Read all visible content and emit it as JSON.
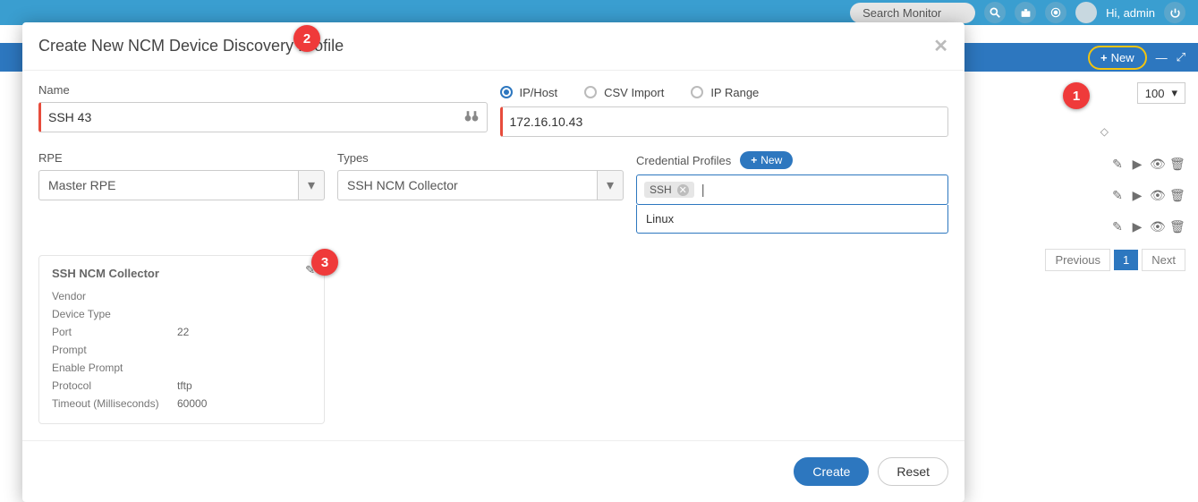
{
  "topbar": {
    "search_placeholder": "Search Monitor",
    "greeting": "Hi, admin"
  },
  "bluebar": {
    "new_label": "New"
  },
  "page": {
    "page_size": "100",
    "pager_prev": "Previous",
    "pager_next": "Next",
    "pager_current": "1"
  },
  "modal": {
    "title": "Create New NCM Device Discovery Profile",
    "name_label": "Name",
    "name_value": "SSH 43",
    "rpe_label": "RPE",
    "rpe_value": "Master RPE",
    "types_label": "Types",
    "types_value": "SSH NCM Collector",
    "cred_label": "Credential Profiles",
    "cred_new": "New",
    "tag_value": "SSH",
    "dropdown_option": "Linux",
    "radio_iphost": "IP/Host",
    "radio_csv": "CSV Import",
    "radio_range": "IP Range",
    "iphost_value": "172.16.10.43",
    "create_btn": "Create",
    "reset_btn": "Reset"
  },
  "details": {
    "title": "SSH NCM Collector",
    "rows": [
      {
        "k": "Vendor",
        "v": ""
      },
      {
        "k": "Device Type",
        "v": ""
      },
      {
        "k": "Port",
        "v": "22"
      },
      {
        "k": "Prompt",
        "v": ""
      },
      {
        "k": "Enable Prompt",
        "v": ""
      },
      {
        "k": "Protocol",
        "v": "tftp"
      },
      {
        "k": "Timeout (Milliseconds)",
        "v": "60000"
      }
    ]
  },
  "annotations": {
    "a1": "1",
    "a2": "2",
    "a3": "3"
  }
}
